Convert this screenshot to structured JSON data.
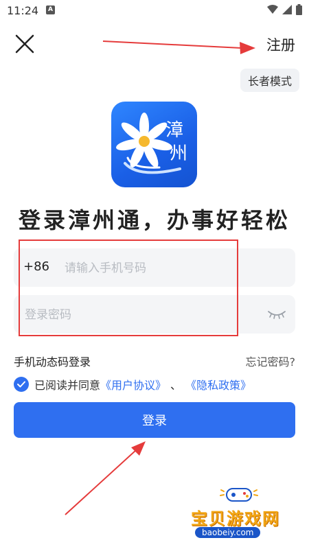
{
  "status_bar": {
    "time": "11:24",
    "notification_icon": "a-badge-icon"
  },
  "header": {
    "register_label": "注册",
    "elder_mode_label": "长者模式"
  },
  "logo": {
    "text_line1": "漳",
    "text_line2": "州"
  },
  "slogan": "登录漳州通，办事好轻松",
  "phone_field": {
    "country_code": "+86",
    "placeholder": "请输入手机号码"
  },
  "password_field": {
    "placeholder": "登录密码"
  },
  "links": {
    "sms_login": "手机动态码登录",
    "forgot_password": "忘记密码?"
  },
  "agreement": {
    "prefix": "已阅读并同意",
    "user_agreement": "《用户协议》",
    "separator": "、",
    "privacy_policy": "《隐私政策》",
    "checked": true
  },
  "login_button_label": "登录",
  "watermark": {
    "name": "宝贝游戏网",
    "url": "baobeiy.com"
  },
  "colors": {
    "primary": "#2f6ff0",
    "annotation": "#e53b3b"
  }
}
